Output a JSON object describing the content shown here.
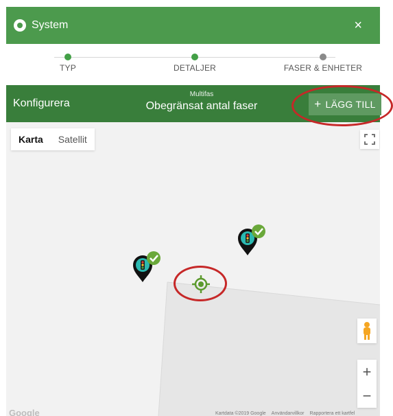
{
  "header": {
    "title": "System",
    "close_label": "×"
  },
  "stepper": {
    "steps": [
      {
        "label": "TYP",
        "state": "complete",
        "color": "#43a047"
      },
      {
        "label": "DETALJER",
        "state": "complete",
        "color": "#43a047"
      },
      {
        "label": "FASER & ENHETER",
        "state": "current",
        "color": "#8a8a8a"
      }
    ]
  },
  "config": {
    "title": "Konfigurera",
    "mode_small": "Multifas",
    "mode_big": "Obegränsat antal faser",
    "add_plus": "+",
    "add_label": "LÄGG TILL"
  },
  "map": {
    "toggle": {
      "map_label": "Karta",
      "satellite_label": "Satellit"
    },
    "zoom_in": "+",
    "zoom_out": "−",
    "google_logo": "Google",
    "attribution": [
      "Kartdata ©2019 Google",
      "Användarvillkor",
      "Rapportera ett kartfel"
    ]
  },
  "colors": {
    "header": "#4c9a4d",
    "configbar": "#397e3b",
    "accent": "#43a047",
    "annotation": "#c62828"
  },
  "icons": [
    "system-icon",
    "close-icon",
    "fullscreen-icon",
    "pegman-icon",
    "traffic-light-marker-icon",
    "checkmark-icon",
    "locate-target-icon"
  ]
}
